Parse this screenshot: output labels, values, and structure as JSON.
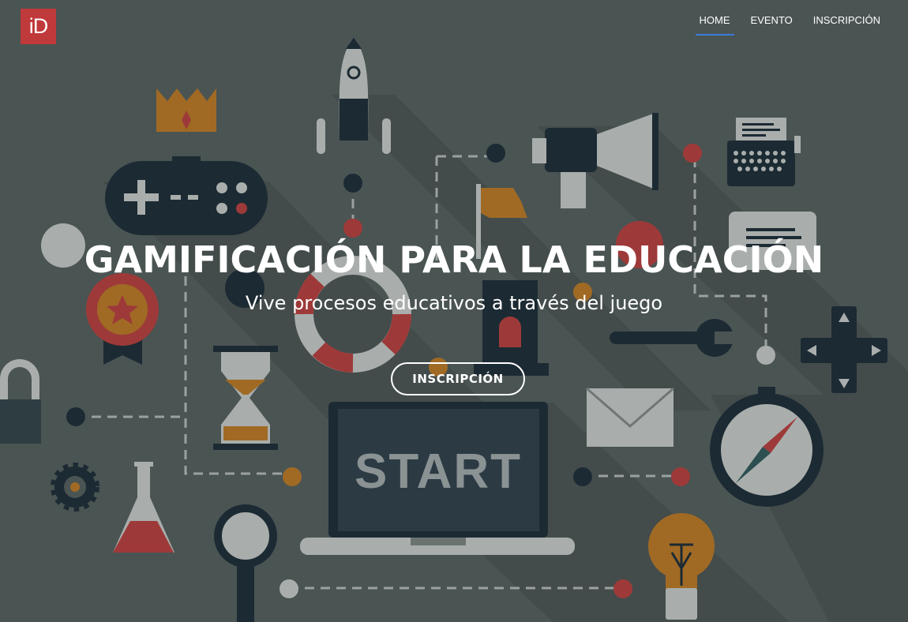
{
  "brand": {
    "logo_text": "iD",
    "logo_color": "#c0393b"
  },
  "nav": {
    "items": [
      {
        "label": "HOME",
        "active": true
      },
      {
        "label": "EVENTO",
        "active": false
      },
      {
        "label": "INSCRIPCIÓN",
        "active": false
      }
    ],
    "active_color": "#3b7dd8"
  },
  "hero": {
    "title": "GAMIFICACIÓN PARA LA EDUCACIÓN",
    "subtitle": "Vive procesos educativos a través del juego",
    "cta_label": "INSCRIPCIÓN",
    "laptop_screen_text": "START",
    "background_color": "#4a5453"
  }
}
